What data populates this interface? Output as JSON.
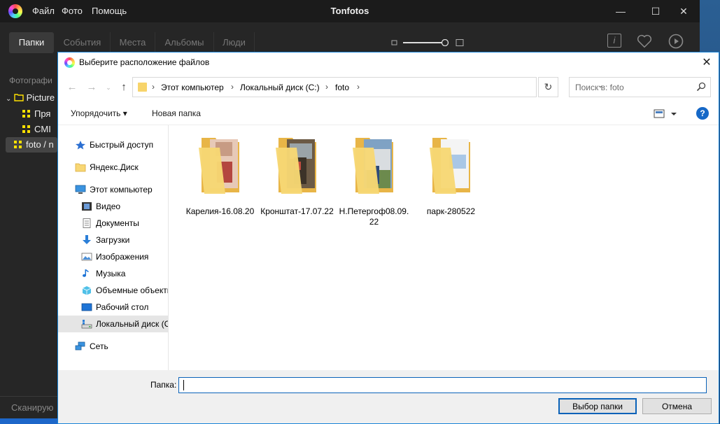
{
  "app": {
    "title": "Tonfotos",
    "menu": [
      "Файл",
      "Фото",
      "Помощь"
    ],
    "tabs": [
      "Папки",
      "События",
      "Места",
      "Альбомы",
      "Люди"
    ],
    "active_tab": "Папки",
    "sidebar": {
      "heading": "Фотографи",
      "items": [
        {
          "label": "Picture",
          "type": "folder-tree"
        },
        {
          "label": "Пря",
          "type": "grid"
        },
        {
          "label": "CMI",
          "type": "grid"
        },
        {
          "label": "foto / n",
          "type": "grid",
          "selected": true
        }
      ],
      "scan_label": "Сканирую"
    },
    "window_controls": {
      "minimize": "—",
      "maximize": "☐",
      "close": "✕"
    },
    "toolbar_icons": {
      "info": "i"
    }
  },
  "dialog": {
    "title": "Выберите расположение файлов",
    "close": "✕",
    "breadcrumb": [
      "Этот компьютер",
      "Локальный диск (C:)",
      "foto"
    ],
    "search_placeholder": "Поиск в: foto",
    "commands": {
      "organize": "Упорядочить ▾",
      "new_folder": "Новая папка"
    },
    "help": "?",
    "nav_items": [
      {
        "label": "Быстрый доступ",
        "icon": "star-icon"
      },
      {
        "label": "Яндекс.Диск",
        "icon": "folder-icon"
      },
      {
        "label": "Этот компьютер",
        "icon": "computer-icon"
      },
      {
        "label": "Видео",
        "icon": "video-icon"
      },
      {
        "label": "Документы",
        "icon": "documents-icon"
      },
      {
        "label": "Загрузки",
        "icon": "downloads-icon"
      },
      {
        "label": "Изображения",
        "icon": "images-icon"
      },
      {
        "label": "Музыка",
        "icon": "music-icon"
      },
      {
        "label": "Объемные объекты",
        "icon": "3d-objects-icon"
      },
      {
        "label": "Рабочий стол",
        "icon": "desktop-icon"
      },
      {
        "label": "Локальный диск (C:)",
        "icon": "drive-icon",
        "selected": true
      },
      {
        "label": "Сеть",
        "icon": "network-icon"
      }
    ],
    "folders": [
      {
        "name": "Карелия-16.08.20"
      },
      {
        "name": "Кронштат-17.07.22"
      },
      {
        "name": "Н.Петергоф08.09.22"
      },
      {
        "name": "парк-280522"
      }
    ],
    "folder_label": "Папка:",
    "folder_value": "",
    "select_button": "Выбор папки",
    "cancel_button": "Отмена"
  }
}
